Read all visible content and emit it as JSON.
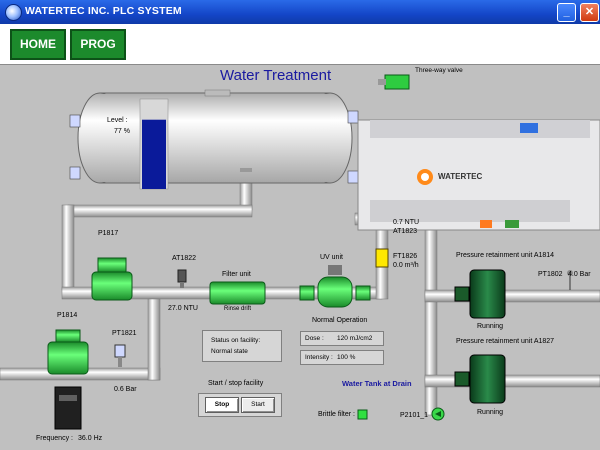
{
  "window": {
    "title": "WATERTEC INC. PLC SYSTEM",
    "buttons": [
      "_",
      "□",
      "✕"
    ]
  },
  "nav": {
    "home": "HOME",
    "prog": "PROG"
  },
  "diagram": {
    "title": "Water Treatment",
    "tank": {
      "level_label": "Level :",
      "level_value": "77 %",
      "level_fraction": 0.77
    },
    "three_way_valve": "Three-way valve",
    "plc_brand": "WATERTEC",
    "pump_p1817": "P1817",
    "at1822": {
      "tag": "AT1822",
      "value": "27.0 NTU"
    },
    "filter_unit": {
      "label": "Filter unit",
      "sublabel": "Rinse drift"
    },
    "uv_unit": {
      "label": "UV unit",
      "status": "Normal Operation"
    },
    "ft1826": {
      "tag": "FT1826",
      "value": "0.0 m³/h"
    },
    "at1823": {
      "value": "0.7 NTU",
      "tag": "AT1823"
    },
    "pump_p1814": "P1814",
    "pt1821": {
      "tag": "PT1821",
      "value": "0.6 Bar"
    },
    "frequency": {
      "label": "Frequency :",
      "value": "36.0 Hz"
    },
    "status": {
      "label": "Status on facility:",
      "value": "Normal state"
    },
    "dose": {
      "label": "Dose :",
      "value": "120 mJ/cm2"
    },
    "intensity": {
      "label": "Intensity :",
      "value": "100 %"
    },
    "start_stop": {
      "label": "Start / stop facility",
      "stop": "Stop",
      "start": "Start"
    },
    "water_tank_drain": "Water Tank at Drain",
    "brittle_filter": "Brittle filter :",
    "p2101": "P2101_1",
    "pressure_unit_1": {
      "label": "Pressure retainment unit A1814",
      "status": "Running"
    },
    "pt1802": {
      "tag": "PT1802",
      "value": "4.0 Bar"
    },
    "pressure_unit_2": {
      "label": "Pressure retainment unit A1827",
      "status": "Running"
    }
  },
  "colors": {
    "pipe": "#e8e8e8",
    "pump_green": "#2ecc40",
    "tank_blue": "#0a1a9a",
    "title_blue": "#1a1aa0"
  }
}
